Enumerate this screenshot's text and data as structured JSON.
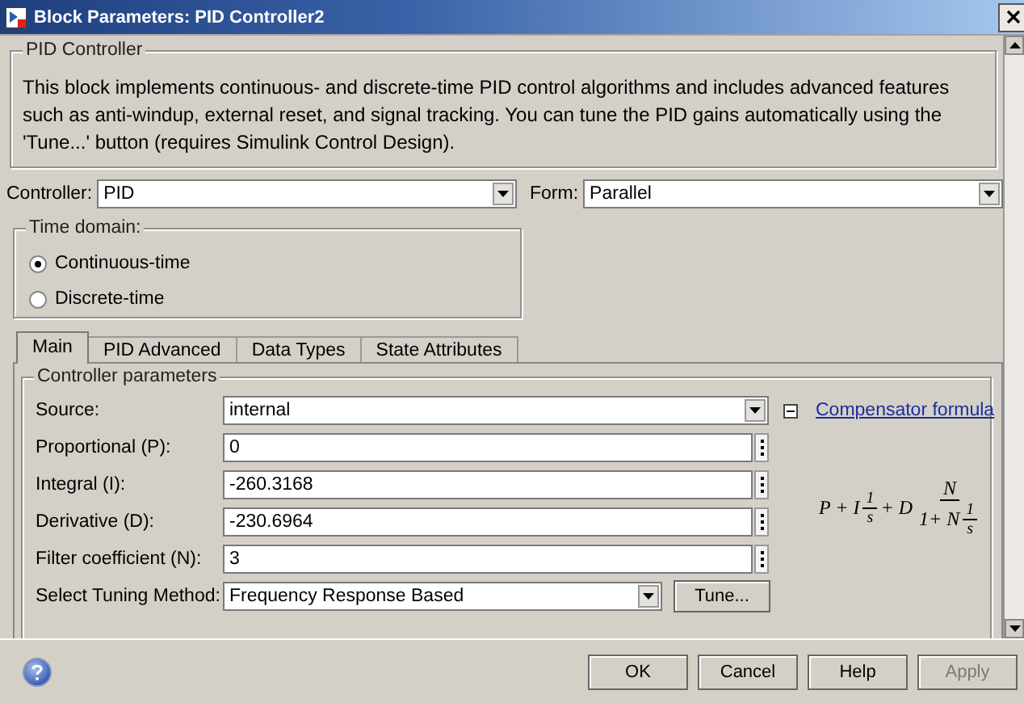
{
  "window": {
    "title": "Block Parameters: PID Controller2"
  },
  "description": {
    "title": "PID Controller",
    "text": "This block implements continuous- and discrete-time PID control algorithms and includes advanced features such as anti-windup, external reset, and signal tracking. You can tune the PID gains automatically using the 'Tune...' button (requires Simulink Control Design)."
  },
  "controller": {
    "label": "Controller:",
    "value": "PID"
  },
  "form": {
    "label": "Form:",
    "value": "Parallel"
  },
  "time_domain": {
    "title": "Time domain:",
    "options": [
      {
        "label": "Continuous-time",
        "selected": true
      },
      {
        "label": "Discrete-time",
        "selected": false
      }
    ]
  },
  "tabs": [
    {
      "label": "Main",
      "selected": true
    },
    {
      "label": "PID Advanced",
      "selected": false
    },
    {
      "label": "Data Types",
      "selected": false
    },
    {
      "label": "State Attributes",
      "selected": false
    }
  ],
  "controller_parameters": {
    "title": "Controller parameters",
    "fields": [
      {
        "kind": "dropdown",
        "label": "Source:",
        "value": "internal"
      },
      {
        "kind": "text",
        "label": "Proportional (P):",
        "value": "0"
      },
      {
        "kind": "text",
        "label": "Integral (I):",
        "value": "-260.3168"
      },
      {
        "kind": "text",
        "label": "Derivative (D):",
        "value": "-230.6964"
      },
      {
        "kind": "text",
        "label": "Filter coefficient (N):",
        "value": "3"
      }
    ],
    "tuning": {
      "label": "Select Tuning Method:",
      "value": "Frequency Response Based",
      "button": "Tune..."
    },
    "formula_section": {
      "label": "Compensator formula",
      "expanded": true
    },
    "formula": {
      "lead": "P + I",
      "frac_num": "1",
      "frac_den": "s",
      "mid": "+ D",
      "num": "N",
      "den_lead": "1+ N",
      "den_frac_num": "1",
      "den_frac_den": "s"
    }
  },
  "buttons": [
    {
      "label": "OK",
      "disabled": false
    },
    {
      "label": "Cancel",
      "disabled": false
    },
    {
      "label": "Help",
      "disabled": false
    },
    {
      "label": "Apply",
      "disabled": true
    }
  ]
}
